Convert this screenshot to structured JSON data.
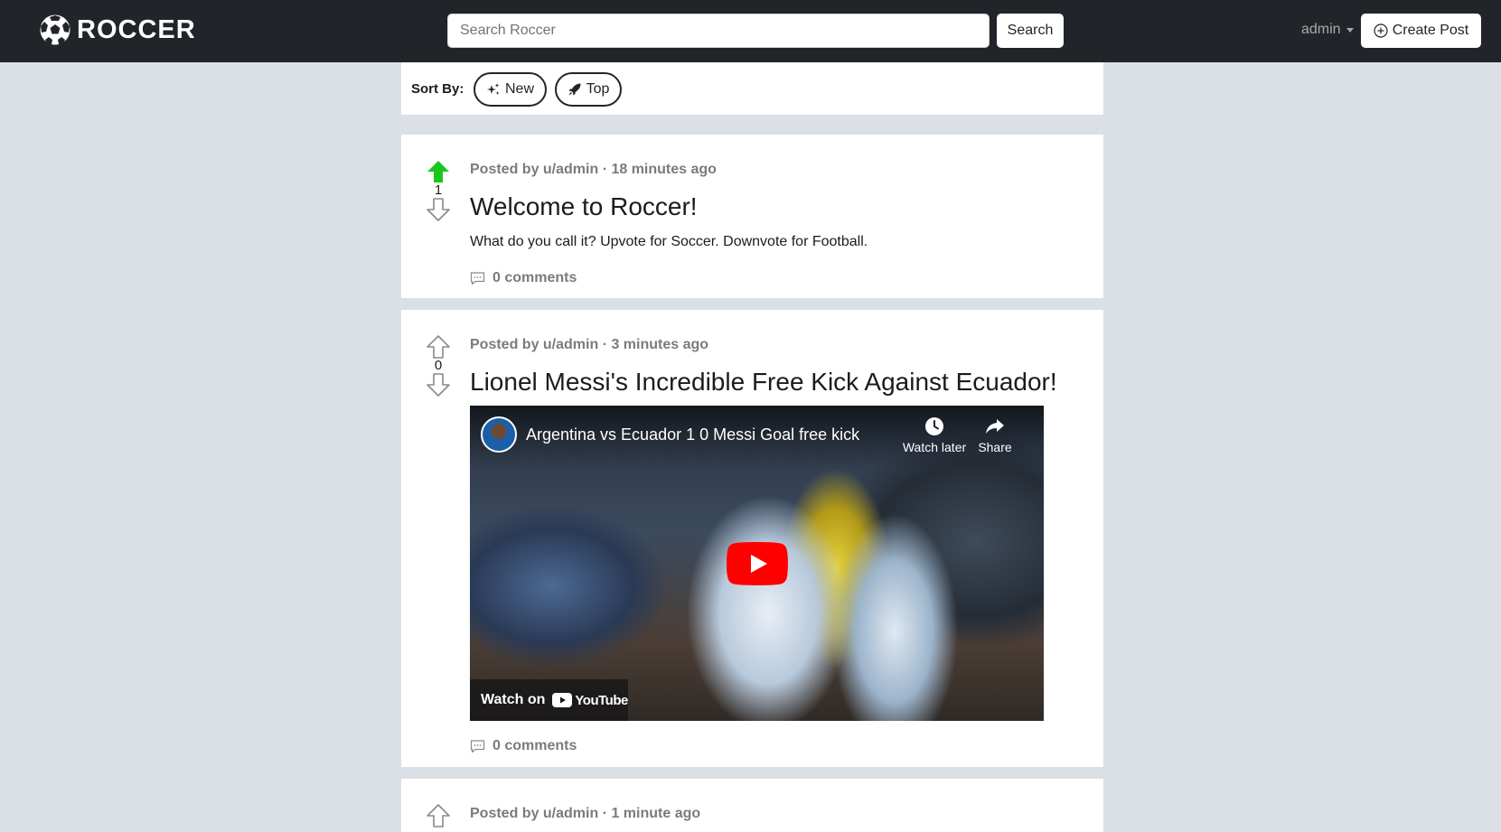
{
  "app": {
    "brand": "ROCCER"
  },
  "search": {
    "placeholder": "Search Roccer",
    "button_label": "Search"
  },
  "user": {
    "name": "admin",
    "create_post_label": "Create Post"
  },
  "sort": {
    "label": "Sort By:",
    "options": [
      {
        "label": "New"
      },
      {
        "label": "Top"
      }
    ]
  },
  "posts": [
    {
      "score": "1",
      "meta": "Posted by u/admin · 18 minutes ago",
      "title": "Welcome to Roccer!",
      "body": "What do you call it? Upvote for Soccer. Downvote for Football.",
      "comments": "0 comments",
      "upvoted": true
    },
    {
      "score": "0",
      "meta": "Posted by u/admin · 3 minutes ago",
      "title": "Lionel Messi's Incredible Free Kick Against Ecuador!",
      "video": {
        "title": "Argentina vs Ecuador 1 0 Messi Goal free kick",
        "watch_later": "Watch later",
        "share": "Share",
        "watch_on": "Watch on",
        "youtube": "YouTube"
      },
      "comments": "0 comments",
      "upvoted": false
    },
    {
      "meta": "Posted by u/admin · 1 minute ago"
    }
  ],
  "colors": {
    "navbar": "#212529",
    "background": "#dae0e6",
    "upvote": "#1cc61c",
    "meta": "#787c7e"
  }
}
